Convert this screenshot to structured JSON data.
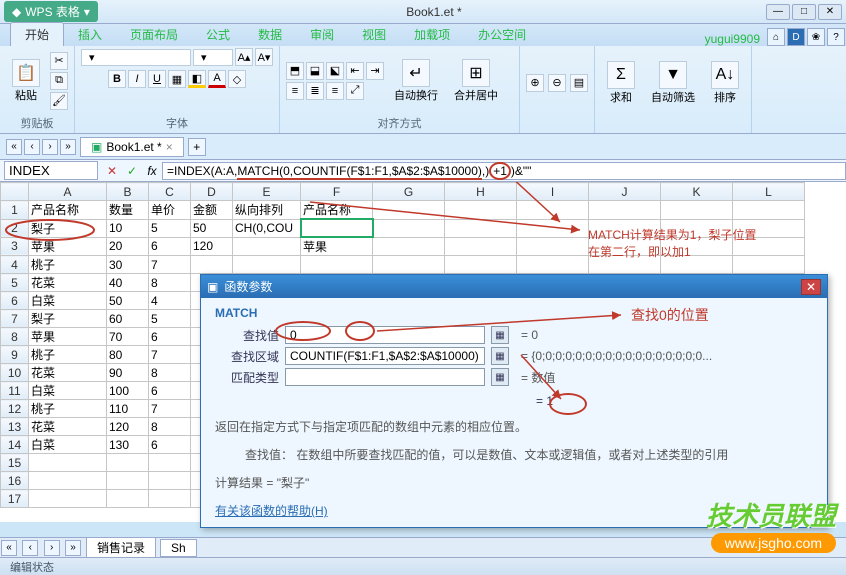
{
  "app": {
    "name": "WPS 表格",
    "doc_title": "Book1.et *",
    "user": "yugui9909"
  },
  "tabs": [
    "开始",
    "插入",
    "页面布局",
    "公式",
    "数据",
    "审阅",
    "视图",
    "加载项",
    "办公空间"
  ],
  "active_tab_index": 0,
  "ribbon": {
    "clipboard": {
      "paste": "粘贴",
      "label": "剪贴板"
    },
    "font": {
      "label": "字体",
      "name_ph": "",
      "size_ph": ""
    },
    "align": {
      "label": "对齐方式",
      "wrap": "自动换行",
      "merge": "合并居中"
    },
    "editing": {
      "sum": "求和",
      "filter": "自动筛选",
      "sort": "排序"
    }
  },
  "workbook_tab": "Book1.et *",
  "namebox": "INDEX",
  "formula": {
    "prefix": "=INDEX(A:A,",
    "u_match": "MATCH(0,",
    "u_countif": "COUNTIF(F$1:F1,$A$2:$A$10000)",
    "mid": ",)",
    "u_plus": "+1",
    "suffix": ")&\"\""
  },
  "columns": [
    "A",
    "B",
    "C",
    "D",
    "E",
    "F",
    "G",
    "H",
    "I",
    "J",
    "K",
    "L"
  ],
  "headers": {
    "A": "产品名称",
    "B": "数量",
    "C": "单价",
    "D": "金额",
    "E": "纵向排列",
    "F": "产品名称"
  },
  "rows": [
    {
      "A": "梨子",
      "B": "10",
      "C": "5",
      "D": "50",
      "E": "CH(0,COU"
    },
    {
      "A": "苹果",
      "B": "20",
      "C": "6",
      "D": "120",
      "F": "苹果"
    },
    {
      "A": "桃子",
      "B": "30",
      "C": "7",
      "D": ""
    },
    {
      "A": "花菜",
      "B": "40",
      "C": "8",
      "D": ""
    },
    {
      "A": "白菜",
      "B": "50",
      "C": "4",
      "D": ""
    },
    {
      "A": "梨子",
      "B": "60",
      "C": "5",
      "D": ""
    },
    {
      "A": "苹果",
      "B": "70",
      "C": "6",
      "D": ""
    },
    {
      "A": "桃子",
      "B": "80",
      "C": "7",
      "D": ""
    },
    {
      "A": "花菜",
      "B": "90",
      "C": "8",
      "D": ""
    },
    {
      "A": "白菜",
      "B": "100",
      "C": "6",
      "D": ""
    },
    {
      "A": "桃子",
      "B": "110",
      "C": "7",
      "D": ""
    },
    {
      "A": "花菜",
      "B": "120",
      "C": "8",
      "D": ""
    },
    {
      "A": "白菜",
      "B": "130",
      "C": "6",
      "D": ""
    }
  ],
  "annotations": {
    "match_result": "MATCH计算结果为1，梨子位置",
    "match_result2": "在第二行，即以加1",
    "find_zero": "查找0的位置"
  },
  "dialog": {
    "title": "函数参数",
    "func": "MATCH",
    "rows": [
      {
        "label": "查找值",
        "value": "0",
        "result": "= 0"
      },
      {
        "label": "查找区域",
        "value": "COUNTIF(F$1:F1,$A$2:$A$10000)",
        "result": "= {0;0;0;0;0;0;0;0;0;0;0;0;0;0;0;0;0..."
      },
      {
        "label": "匹配类型",
        "value": "",
        "result": "= 数值"
      }
    ],
    "preview": "= 1",
    "desc1": "返回在指定方式下与指定项匹配的数组中元素的相应位置。",
    "desc2": "查找值：  在数组中所要查找匹配的值，可以是数值、文本或逻辑值，或者对上述类型的引用",
    "calc_label": "计算结果 = ",
    "calc_value": "\"梨子\"",
    "help": "有关该函数的帮助(H)"
  },
  "sheets": [
    "销售记录",
    "Sh"
  ],
  "status": "编辑状态",
  "watermark": {
    "line1": "技术员联盟",
    "line2": "www.jsgho.com"
  }
}
